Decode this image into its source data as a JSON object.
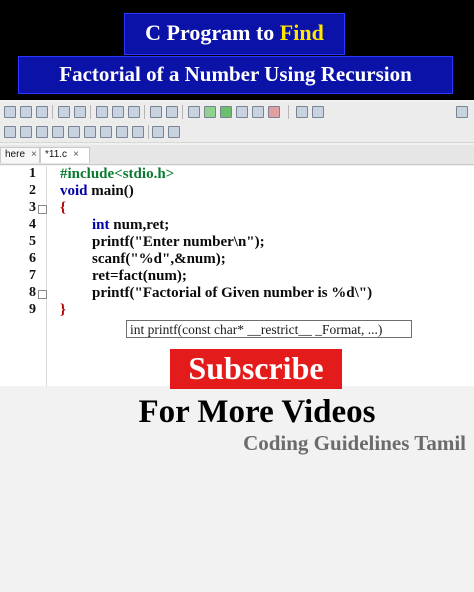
{
  "banner": {
    "line1_prefix": "C Program to ",
    "line1_highlight": "Find",
    "line2": "Factorial of a Number Using Recursion"
  },
  "tabs": [
    {
      "label": "here",
      "close": "×"
    },
    {
      "label": "*11.c",
      "close": "×"
    }
  ],
  "editor": {
    "line_numbers": [
      "1",
      "2",
      "3",
      "4",
      "5",
      "6",
      "7",
      "8",
      "9"
    ],
    "lines": {
      "l1": "#include<stdio.h>",
      "l2_kw": "void",
      "l2_rest": " main()",
      "l3": "{",
      "l4_kw": "int",
      "l4_rest": " num,ret;",
      "l5": "printf(\"Enter number\\n\");",
      "l6": "scanf(\"%d\",&num);",
      "l7": "ret=fact(num);",
      "l8": "printf(\"Factorial of Given number is %d\\\")",
      "l9": "}"
    },
    "tooltip": "int printf(const char* __restrict__ _Format, ...)"
  },
  "overlay": {
    "subscribe": "Subscribe",
    "more": "For More Videos",
    "channel": "Coding Guidelines Tamil"
  },
  "colors": {
    "banner_bg": "#0a12a8",
    "highlight": "#ffe600",
    "subscribe_bg": "#e41b1b",
    "preprocessor": "#0a7a2f",
    "keyword": "#0000a8"
  }
}
